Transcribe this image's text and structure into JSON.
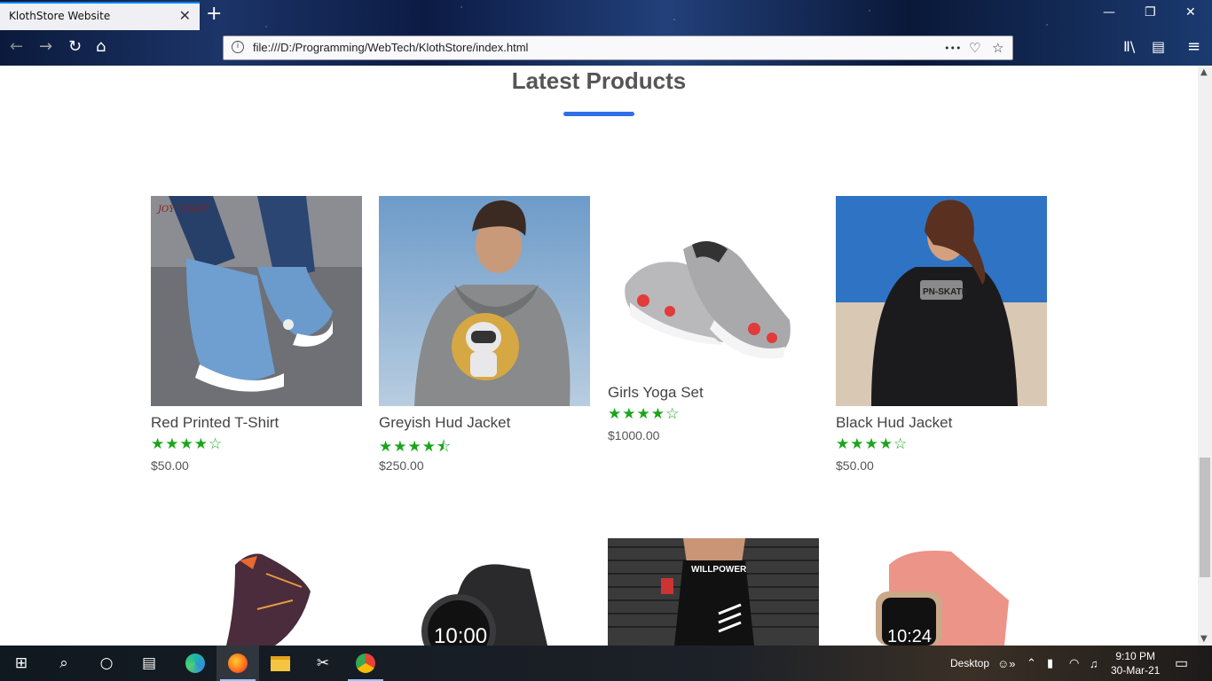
{
  "browser": {
    "tab_title": "KlothStore Website",
    "close_tab": "✕",
    "new_tab": "+",
    "url": "file:///D:/Programming/WebTech/KlothStore/index.html",
    "more": "•••"
  },
  "section": {
    "title": "Latest Products",
    "accent_color": "#2f6fe8"
  },
  "products": [
    {
      "name": "Red Printed T-Shirt",
      "stars": "★★★★☆",
      "price": "$50.00",
      "image": "denim-sneakers"
    },
    {
      "name": "Greyish Hud Jacket",
      "stars": "★★★★⯪",
      "price": "$250.00",
      "image": "grey-astronaut-hoodie"
    },
    {
      "name": "Girls Yoga Set",
      "stars": "★★★★☆",
      "price": "$1000.00",
      "image": "grey-red-slip-on-shoes"
    },
    {
      "name": "Black Hud Jacket",
      "stars": "★★★★☆",
      "price": "$50.00",
      "image": "black-skate-hoodie"
    }
  ],
  "row2_images": [
    "knit-sock",
    "black-smartwatch",
    "willpower-leggings",
    "pink-smartwatch"
  ],
  "image_text": {
    "brand_logo": "JOY VISIST",
    "watch1_time": "10:00",
    "watch2_time": "10:24",
    "leggings_print": "WILLPOWER",
    "hoodie_print": "PN-SKATE"
  },
  "star_color": "#1aa51a",
  "taskbar": {
    "desktop_label": "Desktop",
    "time": "9:10 PM",
    "date": "30-Mar-21"
  }
}
